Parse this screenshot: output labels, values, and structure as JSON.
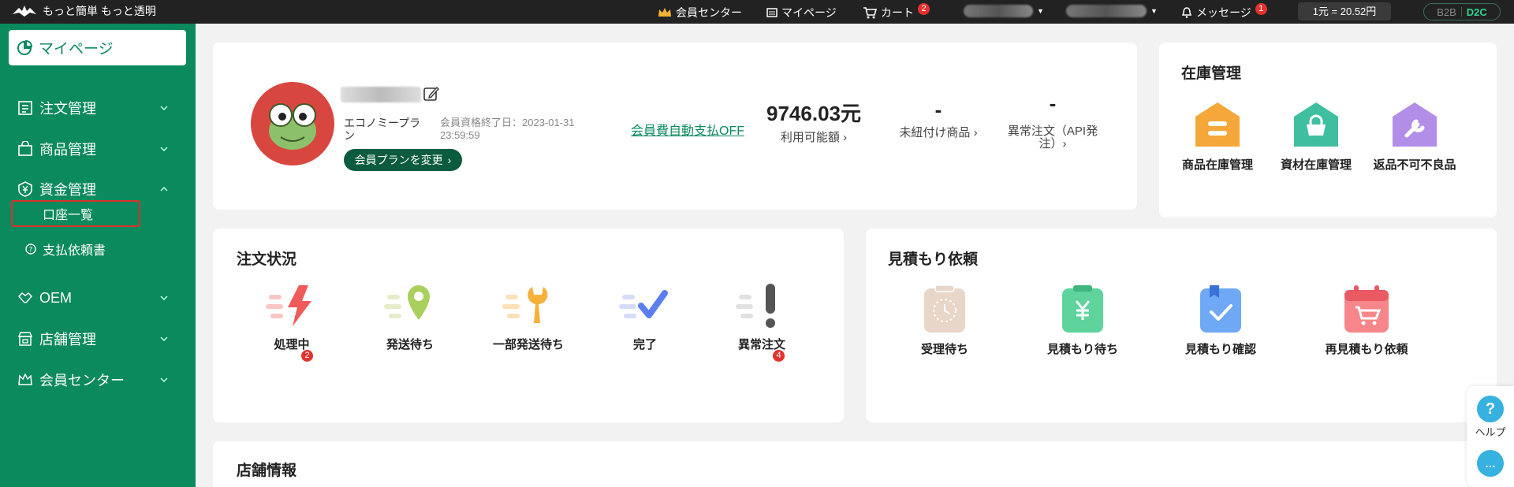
{
  "topbar": {
    "logo_text": "もっと簡単 もっと透明",
    "member_center": "会員センター",
    "mypage": "マイページ",
    "cart": "カート",
    "cart_count": "2",
    "messages": "メッセージ",
    "messages_count": "1",
    "exchange_rate": "1元 = 20.52円",
    "b2b": "B2B",
    "d2c": "D2C"
  },
  "sidebar": {
    "active": "マイページ",
    "items": [
      {
        "label": "注文管理"
      },
      {
        "label": "商品管理"
      },
      {
        "label": "資金管理"
      },
      {
        "label": "OEM"
      },
      {
        "label": "店舗管理"
      },
      {
        "label": "会員センター"
      }
    ],
    "sub": {
      "account_list": "口座一覧",
      "payment_request": "支払依頼書"
    }
  },
  "profile": {
    "plan": "エコノミープラン",
    "expire": "会員資格終了日：2023-01-31 23:59:59",
    "change_plan": "会員プランを変更",
    "autopay": "会員費自動支払OFF",
    "stats": [
      {
        "value": "9746.03元",
        "label": "利用可能額 ›"
      },
      {
        "value": "-",
        "label": "未紐付け商品 ›"
      },
      {
        "value": "-",
        "label": "異常注文（API発注）›"
      }
    ]
  },
  "inventory": {
    "title": "在庫管理",
    "items": [
      {
        "label": "商品在庫管理",
        "color": "#f5a73a"
      },
      {
        "label": "資材在庫管理",
        "color": "#3fbfa0"
      },
      {
        "label": "返品不可不良品",
        "color": "#b28ee8"
      }
    ]
  },
  "orders": {
    "title": "注文状況",
    "items": [
      {
        "label": "処理中",
        "badge": "2"
      },
      {
        "label": "発送待ち",
        "badge": ""
      },
      {
        "label": "一部発送待ち",
        "badge": ""
      },
      {
        "label": "完了",
        "badge": ""
      },
      {
        "label": "異常注文",
        "badge": "4"
      }
    ]
  },
  "quotes": {
    "title": "見積もり依頼",
    "items": [
      {
        "label": "受理待ち"
      },
      {
        "label": "見積もり待ち"
      },
      {
        "label": "見積もり確認"
      },
      {
        "label": "再見積もり依頼"
      }
    ]
  },
  "store": {
    "title": "店舗情報"
  },
  "float": {
    "help": "ヘルプ"
  }
}
